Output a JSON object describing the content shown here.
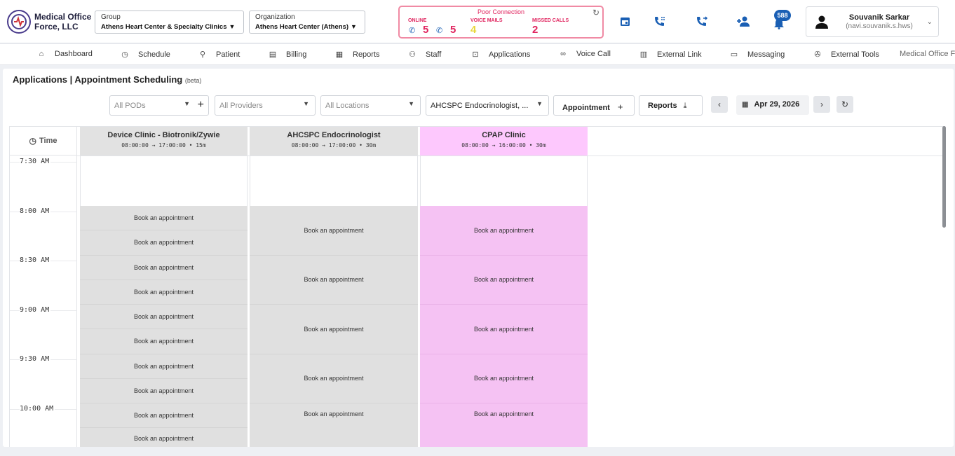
{
  "brand": {
    "mark": "MOF",
    "line1": "Medical Office",
    "line2": "Force, LLC"
  },
  "group": {
    "label": "Group",
    "value": "Athens Heart Center & Specialty Clinics"
  },
  "organization": {
    "label": "Organization",
    "value": "Athens Heart Center (Athens)"
  },
  "status": {
    "title": "Poor Connection",
    "online_label": "ONLINE",
    "online_a": "5",
    "online_b": "5",
    "voicemail_label": "VOICE MAILS",
    "voicemail_count": "4",
    "missed_label": "MISSED CALLS",
    "missed_count": "2"
  },
  "notifications": {
    "count": "588"
  },
  "user": {
    "name": "Souvanik Sarkar",
    "id": "(navi.souvanik.s.hws)"
  },
  "nav": {
    "items": [
      "Dashboard",
      "Schedule",
      "Patient",
      "Billing",
      "Reports",
      "Staff",
      "Applications",
      "Voice Call",
      "External Link",
      "Messaging",
      "External Tools"
    ],
    "extra": "Medical Office Fo"
  },
  "page": {
    "title": "Applications | Appointment Scheduling",
    "beta": "(beta)"
  },
  "filters": {
    "pods": "All PODs",
    "providers": "All Providers",
    "locations": "All Locations",
    "location_selected": "AHCSPC Endocrinologist, ...",
    "appointment_btn": "Appointment",
    "reports_btn": "Reports",
    "date": "Apr 29, 2026"
  },
  "schedule": {
    "time_header": "Time",
    "time_labels": [
      "7:30 AM",
      "8:00 AM",
      "8:30 AM",
      "9:00 AM",
      "9:30 AM",
      "10:00 AM"
    ],
    "book_label": "Book an appointment",
    "columns": [
      {
        "name": "Device Clinic - Biotronik/Zywie",
        "hours": "08:00:00 → 17:00:00 • 15m",
        "slot_minutes": 15,
        "color": "#e0e0e0"
      },
      {
        "name": "AHCSPC Endocrinologist",
        "hours": "08:00:00 → 17:00:00 • 30m",
        "slot_minutes": 30,
        "color": "#e0e0e0"
      },
      {
        "name": "CPAP Clinic",
        "hours": "08:00:00 → 16:00:00 • 30m",
        "slot_minutes": 30,
        "color": "#f5c2f3"
      }
    ]
  },
  "colors": {
    "accent": "#1a5fb4",
    "alert": "#e0245e",
    "voicemail": "#e8d73a",
    "cpap_header": "#fdc8fd"
  }
}
